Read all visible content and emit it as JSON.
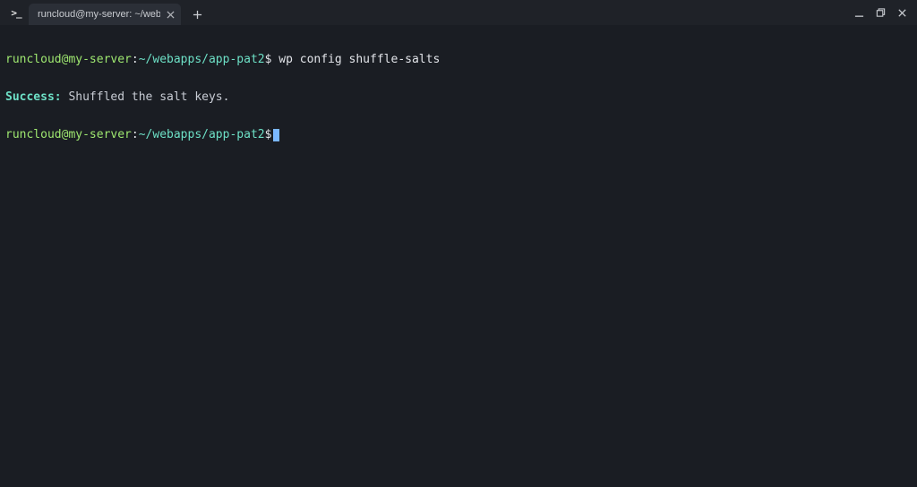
{
  "window": {
    "app_icon_label": ">_",
    "tab_title": "runcloud@my-server: ~/webapps/a"
  },
  "terminal": {
    "lines": [
      {
        "prompt_user_host": "runcloud@my-server",
        "prompt_sep": ":",
        "prompt_path": "~/webapps/app-pat2",
        "prompt_suffix": "$",
        "command": "wp config shuffle-salts"
      },
      {
        "success_label": "Success:",
        "message": " Shuffled the salt keys."
      },
      {
        "prompt_user_host": "runcloud@my-server",
        "prompt_sep": ":",
        "prompt_path": "~/webapps/app-pat2",
        "prompt_suffix": "$",
        "command": ""
      }
    ]
  }
}
